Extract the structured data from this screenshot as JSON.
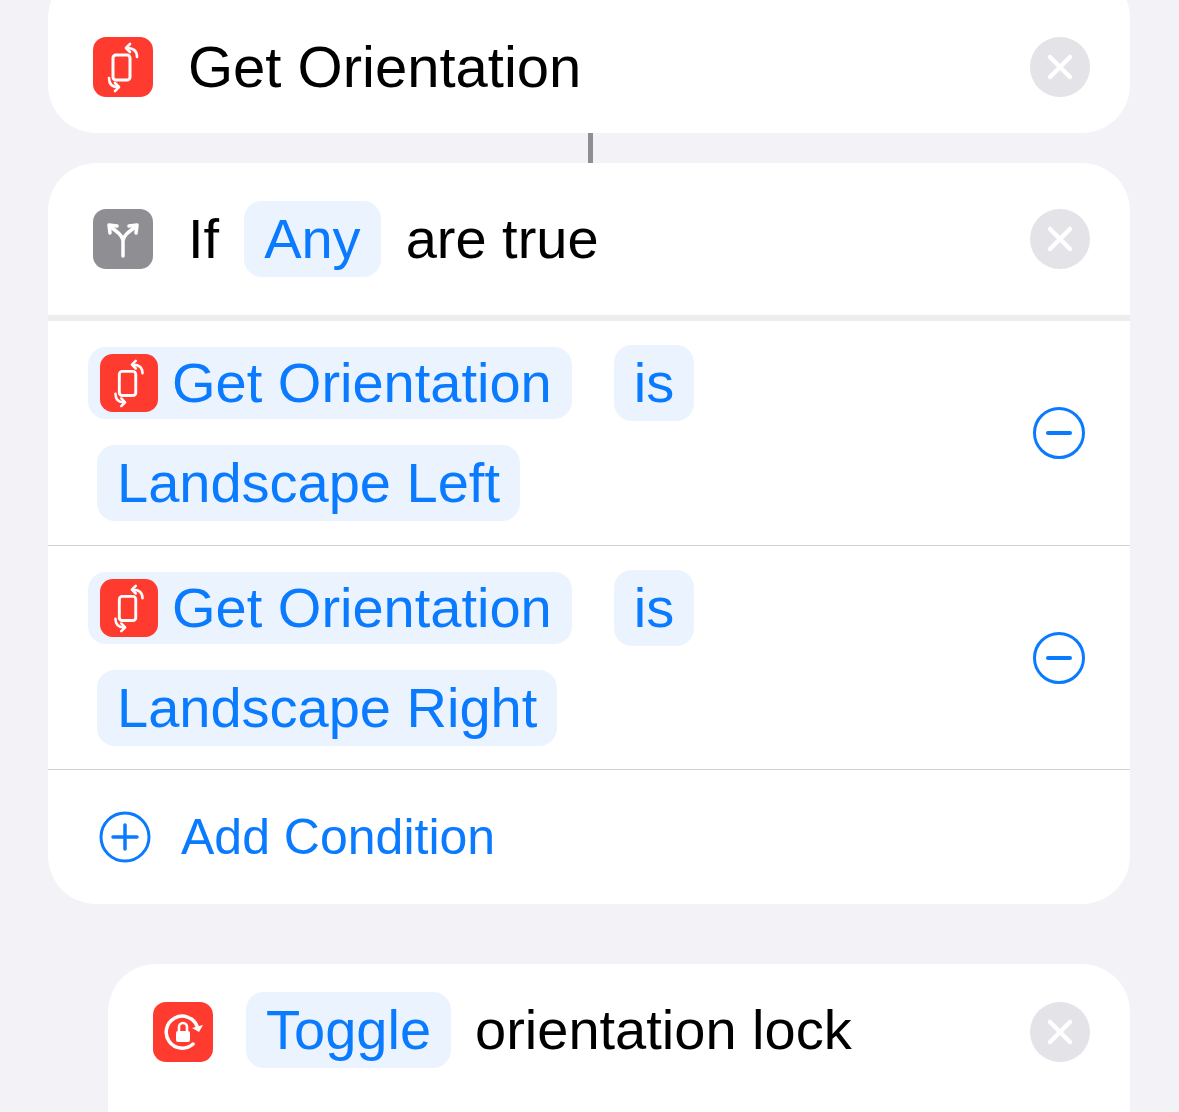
{
  "top_action": {
    "title": "Get Orientation"
  },
  "if_block": {
    "keyword": "If",
    "mode": "Any",
    "suffix": "are true",
    "conditions": [
      {
        "subject": "Get Orientation",
        "operator": "is",
        "value": "Landscape Left"
      },
      {
        "subject": "Get Orientation",
        "operator": "is",
        "value": "Landscape Right"
      }
    ],
    "add_button": "Add Condition"
  },
  "bottom_action": {
    "token": "Toggle",
    "text": "orientation lock"
  }
}
